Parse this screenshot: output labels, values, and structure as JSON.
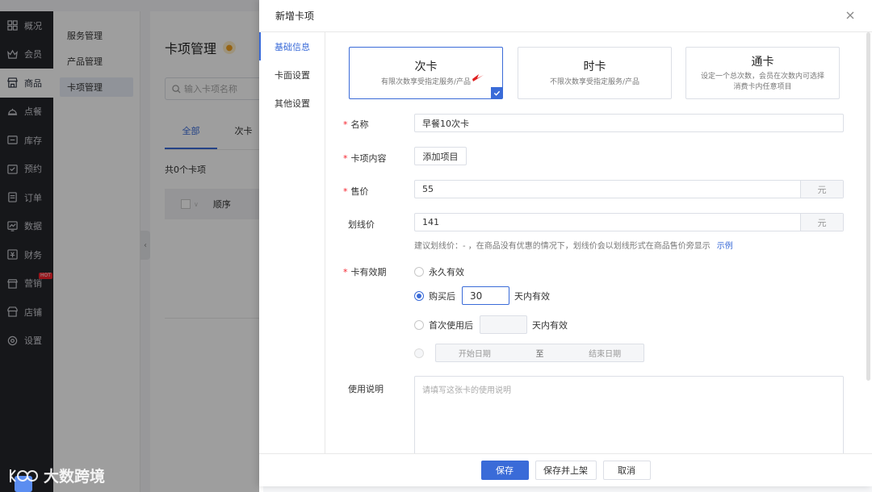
{
  "nav": {
    "items": [
      {
        "label": "概况",
        "icon": "dashboard-icon"
      },
      {
        "label": "会员",
        "icon": "crown-icon"
      },
      {
        "label": "商品",
        "icon": "store-icon",
        "active": true
      },
      {
        "label": "点餐",
        "icon": "dish-icon"
      },
      {
        "label": "库存",
        "icon": "box-icon"
      },
      {
        "label": "预约",
        "icon": "calendar-check-icon"
      },
      {
        "label": "订单",
        "icon": "order-icon"
      },
      {
        "label": "数据",
        "icon": "chart-icon"
      },
      {
        "label": "财务",
        "icon": "finance-icon"
      },
      {
        "label": "营销",
        "icon": "marketing-icon",
        "badge": "HOT"
      },
      {
        "label": "店铺",
        "icon": "shop-icon"
      },
      {
        "label": "设置",
        "icon": "gear-icon"
      }
    ]
  },
  "subnav": {
    "items": [
      {
        "label": "服务管理"
      },
      {
        "label": "产品管理"
      },
      {
        "label": "卡项管理",
        "active": true
      }
    ]
  },
  "page": {
    "title": "卡项管理",
    "search_placeholder": "输入卡项名称",
    "tabs": [
      "全部",
      "次卡"
    ],
    "count_text": "共0个卡项",
    "table_header_order": "顺序"
  },
  "watermark": {
    "text": "大数跨境"
  },
  "drawer": {
    "title": "新增卡项",
    "tabs": [
      "基础信息",
      "卡面设置",
      "其他设置"
    ],
    "card_types": [
      {
        "title": "次卡",
        "desc": "有限次数享受指定服务/产品",
        "selected": true
      },
      {
        "title": "时卡",
        "desc": "不限次数享受指定服务/产品",
        "selected": false
      },
      {
        "title": "通卡",
        "desc": "设定一个总次数，会员在次数内可选择消费卡内任意项目",
        "selected": false
      }
    ],
    "form": {
      "name_label": "名称",
      "name_value": "早餐10次卡",
      "content_label": "卡项内容",
      "add_item_button": "添加项目",
      "price_label": "售价",
      "price_value": "55",
      "price_unit": "元",
      "strike_label": "划线价",
      "strike_value": "141",
      "strike_unit": "元",
      "strike_hint": "建议划线价：- ，在商品没有优惠的情况下，划线价会以划线形式在商品售价旁显示",
      "strike_hint_link": "示例",
      "validity_label": "卡有效期",
      "validity_options": {
        "forever": "永久有效",
        "after_purchase": "购买后",
        "after_purchase_days": "30",
        "after_purchase_suffix": "天内有效",
        "after_first_use": "首次使用后",
        "after_first_use_suffix": "天内有效",
        "range_start": "开始日期",
        "range_sep": "至",
        "range_end": "结束日期"
      },
      "validity_selected": "after_purchase",
      "usage_label": "使用说明",
      "usage_placeholder": "请填写这张卡的使用说明"
    },
    "footer": {
      "save": "保存",
      "save_publish": "保存并上架",
      "cancel": "取消"
    }
  },
  "colors": {
    "primary": "#3a6bd8",
    "nav_bg": "#25262b",
    "required": "#f5222d"
  }
}
